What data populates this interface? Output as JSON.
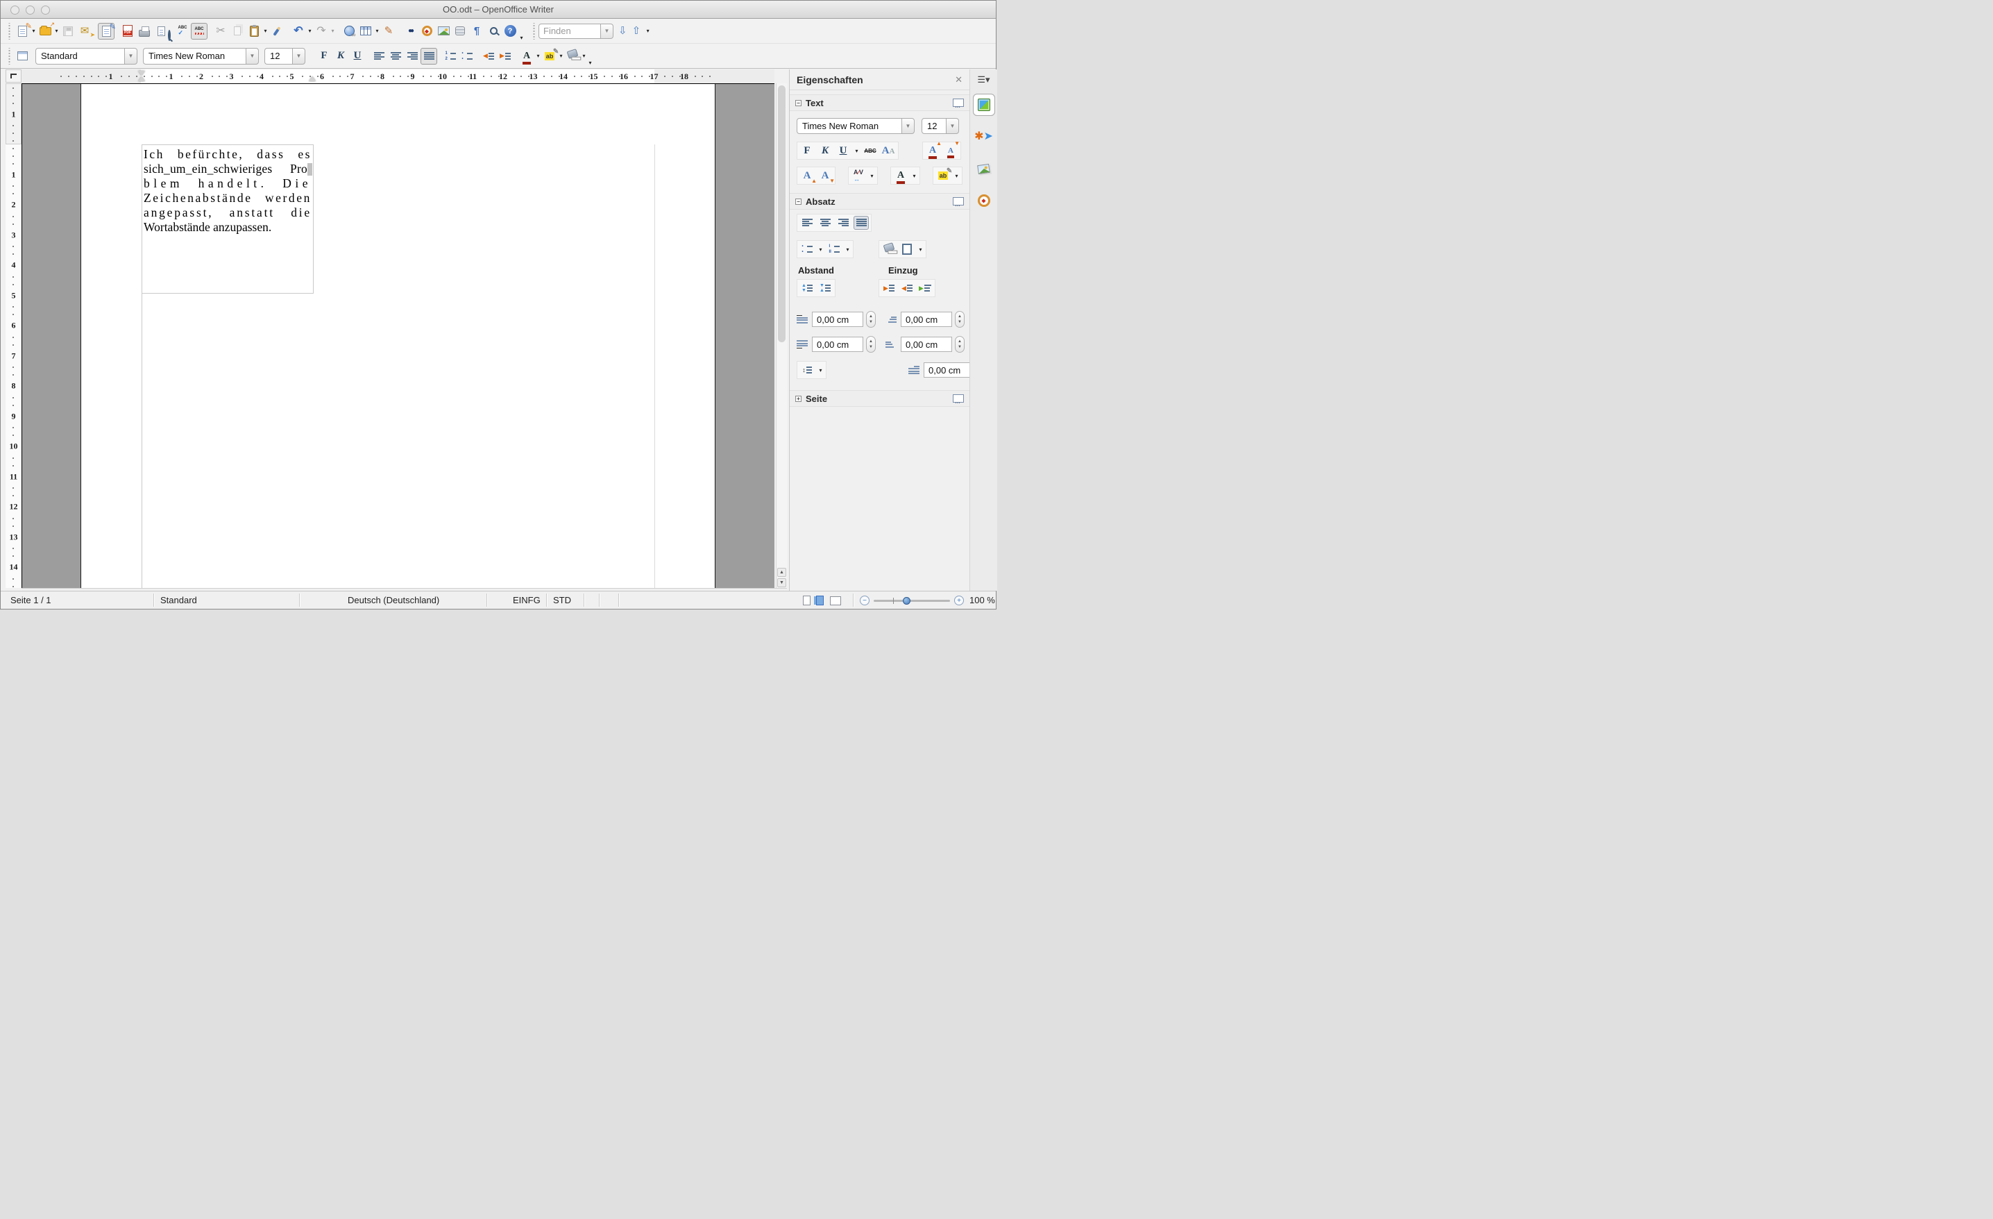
{
  "window": {
    "title": "OO.odt – OpenOffice Writer"
  },
  "toolbar_top": {
    "find_placeholder": "Finden",
    "icons": [
      "new-document",
      "open",
      "save",
      "send-email",
      "edit-file",
      "export-pdf",
      "print",
      "page-preview",
      "spelling",
      "auto-spellcheck",
      "cut",
      "copy",
      "paste",
      "format-paintbrush",
      "undo",
      "redo",
      "hyperlink",
      "table",
      "draw-functions",
      "find-replace",
      "navigator",
      "gallery",
      "data-sources",
      "formatting-marks",
      "zoom",
      "help"
    ]
  },
  "format_toolbar": {
    "style_name": "Standard",
    "font_name": "Times New Roman",
    "font_size": "12",
    "bold_label": "F",
    "italic_label": "K",
    "underline_label": "U",
    "spell_label": "ABC"
  },
  "ruler": {
    "h_margin_number": "1",
    "h_numbers": [
      "1",
      "2",
      "3",
      "4",
      "5",
      "6",
      "7",
      "8",
      "9",
      "10",
      "11",
      "12",
      "13",
      "14",
      "15",
      "16",
      "17",
      "18"
    ],
    "v_margin_number": "1",
    "v_numbers": [
      "1",
      "2",
      "3",
      "4",
      "5",
      "6",
      "7",
      "8",
      "9",
      "10",
      "11",
      "12",
      "13",
      "14"
    ]
  },
  "document": {
    "lines": [
      "Ich befürchte, dass es",
      "sich_um_ein_schwieriges Pro-",
      "blem handelt.  Die",
      "Zeichenabstände werden",
      "angepasst, anstatt die",
      "Wortabstände anzupassen."
    ],
    "letter_spacing": [
      2.5,
      0.2,
      5.5,
      2.6,
      2.8,
      0
    ],
    "justified": [
      true,
      true,
      true,
      true,
      true,
      false
    ]
  },
  "sidebar": {
    "title": "Eigenschaften",
    "close_label": "✕",
    "text_section": {
      "label": "Text",
      "font_name": "Times New Roman",
      "font_size": "12",
      "bold_label": "F",
      "italic_label": "K",
      "underline_label": "U"
    },
    "paragraph_section": {
      "label": "Absatz",
      "spacing_label": "Abstand",
      "indent_label": "Einzug",
      "values": [
        "0,00 cm",
        "0,00 cm",
        "0,00 cm",
        "0,00 cm",
        "0,00 cm"
      ]
    },
    "page_section": {
      "label": "Seite"
    }
  },
  "statusbar": {
    "page": "Seite 1 / 1",
    "style": "Standard",
    "language": "Deutsch (Deutschland)",
    "insert_mode": "EINFG",
    "selection_mode": "STD",
    "zoom_level": "100 %"
  },
  "colors": {
    "accent_blue": "#4a7dbf",
    "highlight_yellow": "#ffe12b",
    "font_color_red": "#a02010",
    "workspace_gray": "#9d9d9d"
  }
}
